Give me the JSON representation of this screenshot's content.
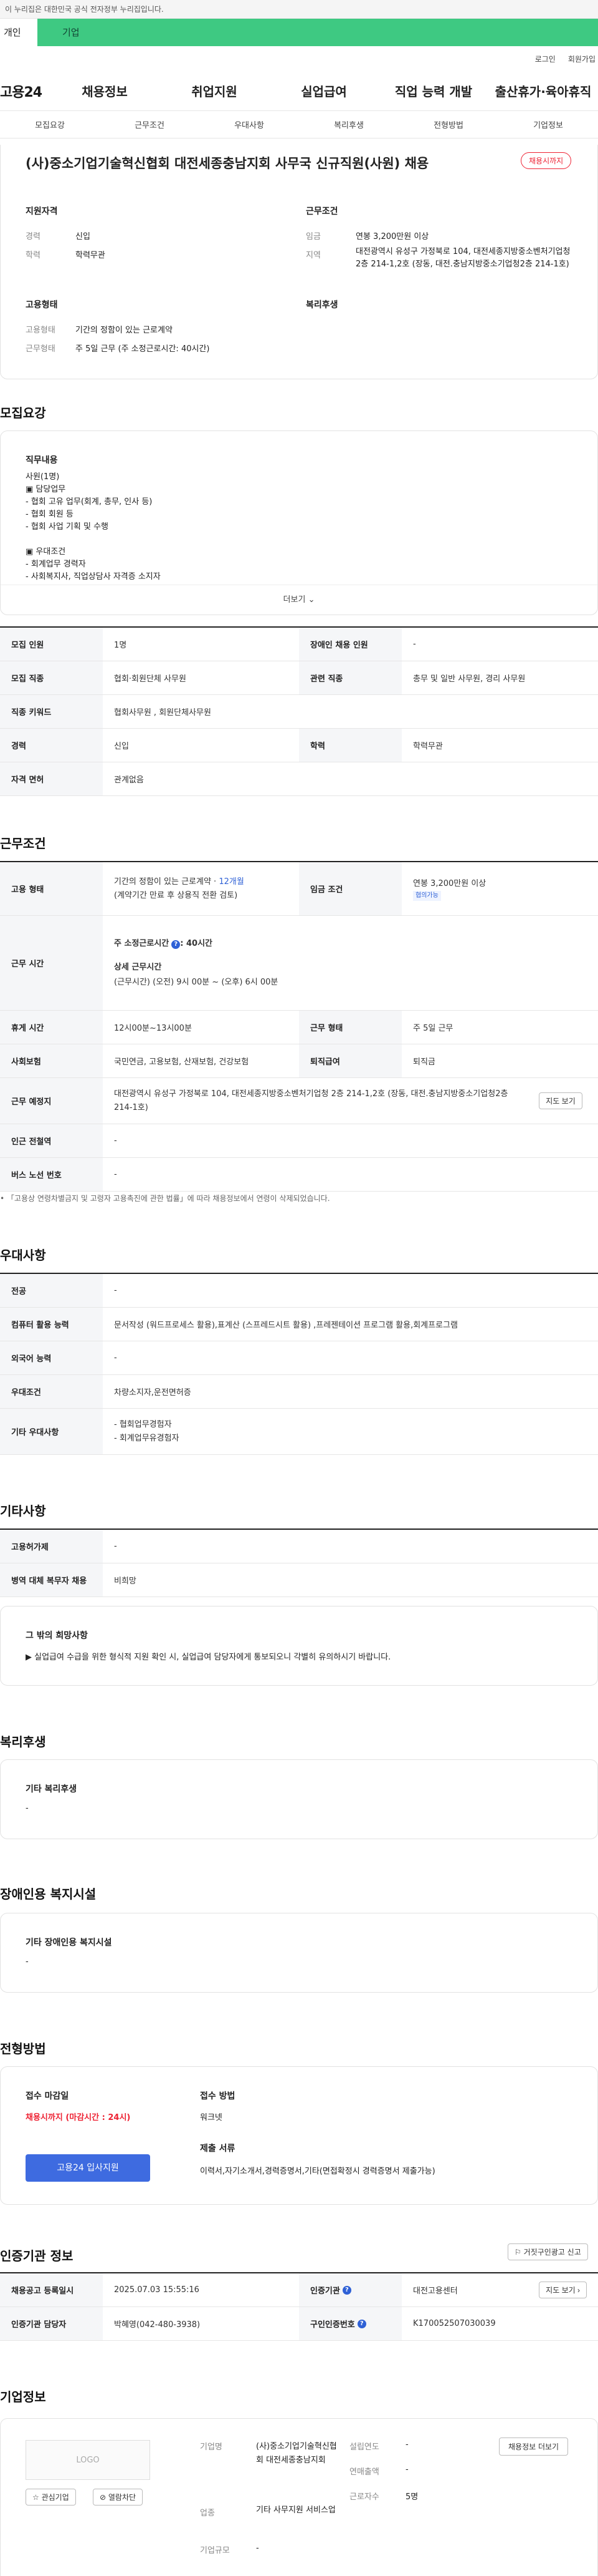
{
  "gov_banner": "이 누리집은 대한민국 공식 전자정부 누리집입니다.",
  "top_tabs": [
    "개인",
    "기업"
  ],
  "util": [
    "로그인",
    "회원가입"
  ],
  "logo": "고용24",
  "gnb": [
    "채용정보",
    "취업지원",
    "실업급여",
    "직업 능력 개발",
    "출산휴가·육아휴직"
  ],
  "subnav": [
    "모집요강",
    "근무조건",
    "우대사항",
    "복리후생",
    "전형방법",
    "기업정보"
  ],
  "header": {
    "title": "(사)중소기업기술혁신협회 대전세종충남지회 사무국 신규직원(사원) 채용",
    "status_badge": "채용시까지",
    "req_title": "지원자격",
    "req_career_label": "경력",
    "req_career": "신입",
    "req_edu_label": "학력",
    "req_edu": "학력무관",
    "cond_title": "근무조건",
    "wage_label": "임금",
    "wage": "연봉 3,200만원 이상",
    "loc_label": "지역",
    "loc": "대전광역시 유성구 가정북로 104, 대전세종지방중소벤처기업청 2층 214-1,2호 (장동, 대전.충남지방중소기업청2층 214-1호)",
    "emp_title": "고용형태",
    "emp_label": "고용형태",
    "emp": "기간의 정함이 있는 근로계약",
    "hours_label": "근무형태",
    "hours": "주 5일 근무 (주 소정근로시간: 40시간)",
    "welfare_title": "복리후생"
  },
  "recruit": {
    "heading": "모집요강",
    "duty_title": "직무내용",
    "duty_lines": [
      "사원(1명)",
      "▣ 담당업무",
      "- 협회 고유 업무(회계, 총무, 인사 등)",
      "- 협회 회원 등",
      "- 협회 사업 기획 및 수행",
      "",
      "▣ 우대조건",
      "- 회계업무 경력자",
      "- 사회복지사, 직업상담사 자격증 소지자"
    ],
    "more": "더보기",
    "rows": [
      [
        "모집 인원",
        "1명",
        "장애인 채용 인원",
        "-"
      ],
      [
        "모집 직종",
        "협회·회원단체 사무원",
        "관련 직종",
        "총무 및 일반 사무원, 경리 사무원"
      ],
      [
        "직종 키워드",
        "협회사무원 , 회원단체사무원"
      ],
      [
        "경력",
        "신입",
        "학력",
        "학력무관"
      ],
      [
        "자격 면허",
        "관계없음"
      ]
    ]
  },
  "work": {
    "heading": "근무조건",
    "emp_label": "고용 형태",
    "emp_main": "기간의 정함이 있는 근로계약 · ",
    "emp_months": "12개월",
    "emp_sub": "(계약기간 만료 후 상용직 전환 검토)",
    "wage_label": "임금 조건",
    "wage": "연봉 3,200만원 이상",
    "wage_tag": "협의가능",
    "time_label": "근무 시간",
    "time_hours": "주 소정근로시간",
    "time_hours_val": ": 40시간",
    "time_detail_title": "상세 근무시간",
    "time_detail": "(근무시간) (오전) 9시 00분 ~ (오후) 6시 00분",
    "rows": [
      [
        "휴게 시간",
        "12시00분~13시00분",
        "근무 형태",
        "주 5일 근무"
      ],
      [
        "사회보험",
        "국민연금, 고용보험, 산재보험, 건강보험",
        "퇴직급여",
        "퇴직금"
      ]
    ],
    "addr_label": "근무 예정지",
    "addr": "대전광역시 유성구 가정북로 104, 대전세종지방중소벤처기업청 2층 214-1,2호 (장동, 대전.충남지방중소기업청2층 214-1호)",
    "map_btn": "지도 보기",
    "subway_label": "인근 전철역",
    "subway": "-",
    "bus_label": "버스 노선 번호",
    "bus": "-",
    "footnote": "「고용상 연령차별금지 및 고령자 고용촉진에 관한 법률」에 따라 채용정보에서 연령이 삭제되었습니다."
  },
  "pref": {
    "heading": "우대사항",
    "rows": [
      [
        "전공",
        "-"
      ],
      [
        "컴퓨터 활용 능력",
        "문서작성 (워드프로세스 활용),표계산 (스프레드시트 활용) ,프레젠테이션 프로그램 활용,회계프로그램"
      ],
      [
        "외국어 능력",
        "-"
      ],
      [
        "우대조건",
        "차량소지자,운전면허증"
      ]
    ],
    "etc_label": "기타 우대사항",
    "etc": [
      "- 협회업무경험자",
      "- 회계업무유경험자"
    ]
  },
  "other": {
    "heading": "기타사항",
    "rows": [
      [
        "고용허가제",
        "-"
      ],
      [
        "병역 대체 복무자 채용",
        "비희망"
      ]
    ],
    "wish_title": "그 밖의 희망사항",
    "wish": "▶ 실업급여 수급을 위한 형식적 지원 확인 시, 실업급여 담당자에게 통보되오니 각별히 유의하시기 바랍니다."
  },
  "welfare": {
    "heading": "복리후생",
    "title": "기타 복리후생",
    "val": "-"
  },
  "disab": {
    "heading": "장애인용 복지시설",
    "title": "기타 장애인용 복지시설",
    "val": "-"
  },
  "select": {
    "heading": "전형방법",
    "deadline_title": "접수 마감일",
    "deadline": "채용시까지 (마감시간 : 24시)",
    "apply_btn": "고용24 입사지원",
    "method_title": "접수 방법",
    "method": "워크넷",
    "docs_title": "제출 서류",
    "docs": "이력서,자기소개서,경력증명서,기타(면접확정시 경력증명서 제출가능)"
  },
  "cert": {
    "heading": "인증기관 정보",
    "report_btn": "거짓구인광고 신고",
    "rows": [
      [
        "채용공고 등록일시",
        "2025.07.03 15:55:16",
        "인증기관",
        "대전고용센터"
      ],
      [
        "인증기관 담당자",
        "박혜영(042-480-3938)",
        "구인인증번호",
        "K170052507030039"
      ]
    ],
    "view_btn": "지도 보기"
  },
  "company": {
    "heading": "기업정보",
    "logo": "LOGO",
    "fav_btn": "관심기업",
    "block_btn": "열람차단",
    "name_label": "기업명",
    "name": "(사)중소기업기술혁신협회 대전세종충남지회",
    "industry_label": "업종",
    "industry": "기타 사무지원 서비스업",
    "size_label": "기업규모",
    "size": "-",
    "year_label": "설립연도",
    "year": "-",
    "sales_label": "연매출액",
    "sales": "-",
    "staff_label": "근로자수",
    "staff": "5명",
    "info_btn": "채용정보 더보기"
  }
}
